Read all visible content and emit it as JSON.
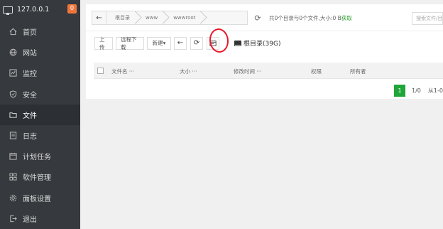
{
  "sidebar": {
    "host": "127.0.0.1",
    "badge": "0",
    "items": [
      {
        "label": "首页",
        "icon": "home-icon"
      },
      {
        "label": "网站",
        "icon": "globe-icon"
      },
      {
        "label": "监控",
        "icon": "monitor-chart-icon"
      },
      {
        "label": "安全",
        "icon": "shield-icon"
      },
      {
        "label": "文件",
        "icon": "folder-icon",
        "active": true
      },
      {
        "label": "日志",
        "icon": "log-icon"
      },
      {
        "label": "计划任务",
        "icon": "calendar-icon"
      },
      {
        "label": "软件管理",
        "icon": "apps-icon"
      },
      {
        "label": "面板设置",
        "icon": "gear-icon"
      },
      {
        "label": "退出",
        "icon": "logout-icon"
      }
    ]
  },
  "breadcrumb": [
    "根目录",
    "www",
    "wwwroot"
  ],
  "summary": {
    "text": "共0个目录与0个文件,大小:0 B",
    "link": "获取"
  },
  "search": {
    "placeholder": "搜索文件/目"
  },
  "toolbar": {
    "upload": "上传",
    "remote_download": "远程下载",
    "new": "新建▾",
    "disk": "根目录(39G)"
  },
  "table": {
    "headers": [
      "文件名 ···",
      "大小 ···",
      "修改时间 ···",
      "权限",
      "所有者"
    ]
  },
  "pager": {
    "current": "1",
    "info": "1/0",
    "range": "从1-0"
  },
  "colors": {
    "sidebar": "#36393d",
    "accent": "#20a53a",
    "annotation": "#e8192c",
    "badge": "#f0753a"
  }
}
